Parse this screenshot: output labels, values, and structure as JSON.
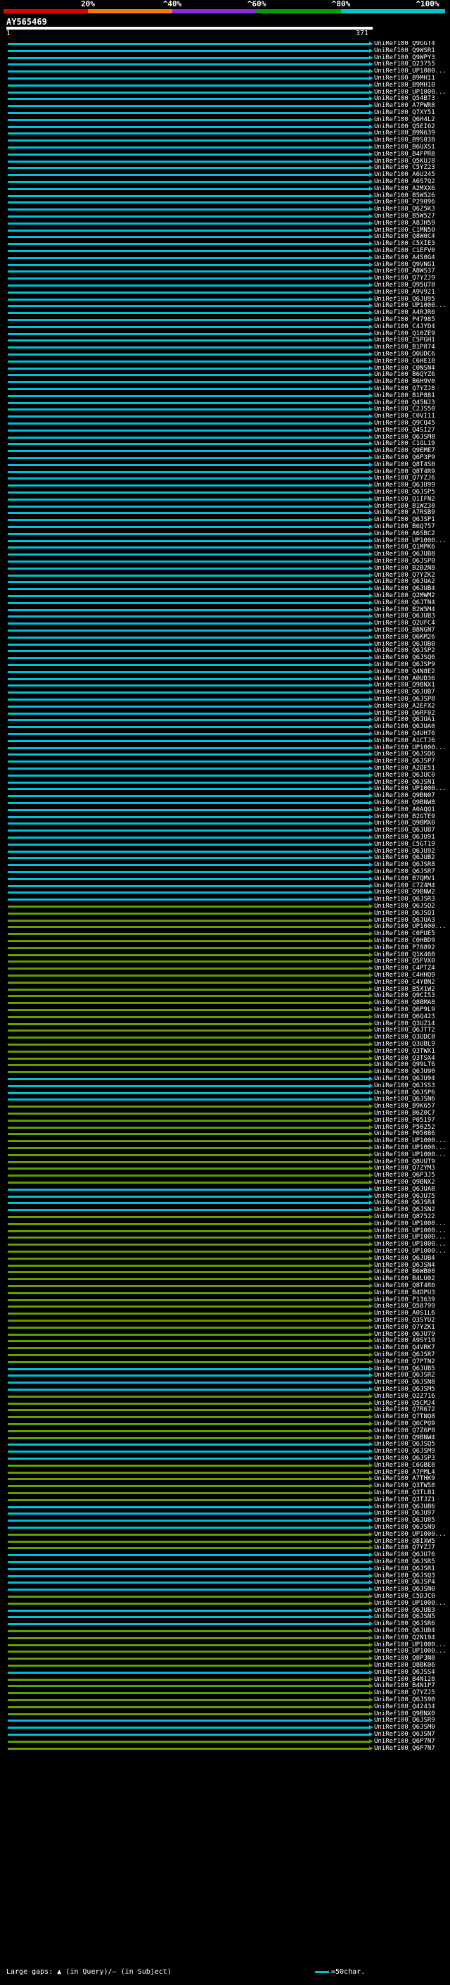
{
  "scale": {
    "ticks": [
      "20%",
      "^40%",
      "^60%",
      "^80%",
      "^100%"
    ],
    "colors": [
      "#e00000",
      "#f07f00",
      "#8a2be2",
      "#00a000",
      "#00c8c8"
    ]
  },
  "query": {
    "name": "AY565469",
    "start": "1",
    "end": "371"
  },
  "hit_colors": {
    "cyan": "#00c0d8",
    "green": "#60a000"
  },
  "hits": [
    {
      "l": "UniRef100_Q9GGT4",
      "c": "cyan"
    },
    {
      "l": "UniRef100_Q9WSR1",
      "c": "cyan"
    },
    {
      "l": "UniRef100_Q9WPY3",
      "c": "cyan"
    },
    {
      "l": "UniRef100_Q23755",
      "c": "cyan"
    },
    {
      "l": "UniRef100_UP1000...",
      "c": "cyan"
    },
    {
      "l": "UniRef100_B9MH11",
      "c": "cyan"
    },
    {
      "l": "UniRef100_B9MH10",
      "c": "cyan"
    },
    {
      "l": "UniRef100_UP1000...",
      "c": "cyan"
    },
    {
      "l": "UniRef100_Q54B73",
      "c": "cyan"
    },
    {
      "l": "UniRef100_A7PWR8",
      "c": "cyan"
    },
    {
      "l": "UniRef100_Q7XY51",
      "c": "cyan"
    },
    {
      "l": "UniRef100_Q6H4L2",
      "c": "cyan"
    },
    {
      "l": "UniRef100_Q5EI62",
      "c": "cyan"
    },
    {
      "l": "UniRef100_B9N639",
      "c": "cyan"
    },
    {
      "l": "UniRef100_B9S038",
      "c": "cyan"
    },
    {
      "l": "UniRef100_B6UXS1",
      "c": "cyan"
    },
    {
      "l": "UniRef100_B4FPR8",
      "c": "cyan"
    },
    {
      "l": "UniRef100_Q5KUJ8",
      "c": "cyan"
    },
    {
      "l": "UniRef100_C5YZ23",
      "c": "cyan"
    },
    {
      "l": "UniRef100_A6U245",
      "c": "cyan"
    },
    {
      "l": "UniRef100_A6S7Q2",
      "c": "cyan"
    },
    {
      "l": "UniRef100_A2MXX6",
      "c": "cyan"
    },
    {
      "l": "UniRef100_B5W526",
      "c": "cyan"
    },
    {
      "l": "UniRef100_P29096",
      "c": "cyan"
    },
    {
      "l": "UniRef100_Q6Z5K3",
      "c": "cyan"
    },
    {
      "l": "UniRef100_B5W527",
      "c": "cyan"
    },
    {
      "l": "UniRef100_A8JH59",
      "c": "cyan"
    },
    {
      "l": "UniRef100_C1MN50",
      "c": "cyan"
    },
    {
      "l": "UniRef100_Q8W0C4",
      "c": "cyan"
    },
    {
      "l": "UniRef100_C5XIE3",
      "c": "cyan"
    },
    {
      "l": "UniRef100_C1EFV0",
      "c": "cyan"
    },
    {
      "l": "UniRef100_A4S0G4",
      "c": "cyan"
    },
    {
      "l": "UniRef100_Q9VNG1",
      "c": "cyan"
    },
    {
      "l": "UniRef100_A8WS37",
      "c": "cyan"
    },
    {
      "l": "UniRef100_Q7YZJ9",
      "c": "cyan"
    },
    {
      "l": "UniRef100_Q95U78",
      "c": "cyan"
    },
    {
      "l": "UniRef100_A9V921",
      "c": "cyan"
    },
    {
      "l": "UniRef100_Q6JU95",
      "c": "cyan"
    },
    {
      "l": "UniRef100_UP1000...",
      "c": "cyan"
    },
    {
      "l": "UniRef100_A4RJR6",
      "c": "cyan"
    },
    {
      "l": "UniRef100_P47985",
      "c": "cyan"
    },
    {
      "l": "UniRef100_C4JYD4",
      "c": "cyan"
    },
    {
      "l": "UniRef100_Q10ZE9",
      "c": "cyan"
    },
    {
      "l": "UniRef100_C5PGH1",
      "c": "cyan"
    },
    {
      "l": "UniRef100_B1P874",
      "c": "cyan"
    },
    {
      "l": "UniRef100_Q0UDC6",
      "c": "cyan"
    },
    {
      "l": "UniRef100_C6HE18",
      "c": "cyan"
    },
    {
      "l": "UniRef100_C0NSN4",
      "c": "cyan"
    },
    {
      "l": "UniRef100_B6QYZ6",
      "c": "cyan"
    },
    {
      "l": "UniRef100_B6H9V0",
      "c": "cyan"
    },
    {
      "l": "UniRef100_Q7YZJ8",
      "c": "cyan"
    },
    {
      "l": "UniRef100_B1P881",
      "c": "cyan"
    },
    {
      "l": "UniRef100_Q45NJ3",
      "c": "cyan"
    },
    {
      "l": "UniRef100_C2JS50",
      "c": "cyan"
    },
    {
      "l": "UniRef100_C0VI11",
      "c": "cyan"
    },
    {
      "l": "UniRef100_Q9CQ45",
      "c": "cyan"
    },
    {
      "l": "UniRef100_Q4SI27",
      "c": "cyan"
    },
    {
      "l": "UniRef100_Q6JSM8",
      "c": "cyan"
    },
    {
      "l": "UniRef100_C1GL19",
      "c": "cyan"
    },
    {
      "l": "UniRef100_Q9EME7",
      "c": "cyan"
    },
    {
      "l": "UniRef100_Q6P3P9",
      "c": "cyan"
    },
    {
      "l": "UniRef100_Q8T4S0",
      "c": "cyan"
    },
    {
      "l": "UniRef100_Q8T4R9",
      "c": "cyan"
    },
    {
      "l": "UniRef100_Q7YZJ6",
      "c": "cyan"
    },
    {
      "l": "UniRef100_Q6JU99",
      "c": "cyan"
    },
    {
      "l": "UniRef100_Q6JSP5",
      "c": "cyan"
    },
    {
      "l": "UniRef100_Q1IFN2",
      "c": "cyan"
    },
    {
      "l": "UniRef100_B1WZ38",
      "c": "cyan"
    },
    {
      "l": "UniRef100_A7RSB9",
      "c": "cyan"
    },
    {
      "l": "UniRef100_Q6JSP1",
      "c": "cyan"
    },
    {
      "l": "UniRef100_B6Q757",
      "c": "cyan"
    },
    {
      "l": "UniRef100_A6SBC2",
      "c": "cyan"
    },
    {
      "l": "UniRef100_UP1000...",
      "c": "cyan"
    },
    {
      "l": "UniRef100_Q1MPK6",
      "c": "cyan"
    },
    {
      "l": "UniRef100_Q6JUB8",
      "c": "cyan"
    },
    {
      "l": "UniRef100_Q6JSP0",
      "c": "cyan"
    },
    {
      "l": "UniRef100_B2B2N8",
      "c": "cyan"
    },
    {
      "l": "UniRef100_Q7YZK2",
      "c": "cyan"
    },
    {
      "l": "UniRef100_Q6JUA2",
      "c": "cyan"
    },
    {
      "l": "UniRef100_Q6JUB4",
      "c": "cyan"
    },
    {
      "l": "UniRef100_Q2MWM2",
      "c": "cyan"
    },
    {
      "l": "UniRef100_Q6JTN4",
      "c": "cyan"
    },
    {
      "l": "UniRef100_B2W5M4",
      "c": "cyan"
    },
    {
      "l": "UniRef100_Q6JUB3",
      "c": "cyan"
    },
    {
      "l": "UniRef100_Q2UFC4",
      "c": "cyan"
    },
    {
      "l": "UniRef100_B8NGN7",
      "c": "cyan"
    },
    {
      "l": "UniRef100_Q6KM26",
      "c": "cyan"
    },
    {
      "l": "UniRef100_Q6JUB0",
      "c": "cyan"
    },
    {
      "l": "UniRef100_Q6JSP2",
      "c": "cyan"
    },
    {
      "l": "UniRef100_Q6JSQ6",
      "c": "cyan"
    },
    {
      "l": "UniRef100_Q6JSP9",
      "c": "cyan"
    },
    {
      "l": "UniRef100_Q4N8E2",
      "c": "cyan"
    },
    {
      "l": "UniRef100_A0UD36",
      "c": "cyan"
    },
    {
      "l": "UniRef100_Q9BNX1",
      "c": "cyan"
    },
    {
      "l": "UniRef100_Q6JUB7",
      "c": "cyan"
    },
    {
      "l": "UniRef100_Q6JSP8",
      "c": "cyan"
    },
    {
      "l": "UniRef100_A2EFX2",
      "c": "cyan"
    },
    {
      "l": "UniRef100_Q6RF02",
      "c": "cyan"
    },
    {
      "l": "UniRef100_Q6JUA1",
      "c": "cyan"
    },
    {
      "l": "UniRef100_Q6JUA0",
      "c": "cyan"
    },
    {
      "l": "UniRef100_Q4UH76",
      "c": "cyan"
    },
    {
      "l": "UniRef100_A1CTJ6",
      "c": "cyan"
    },
    {
      "l": "UniRef100_UP1000...",
      "c": "cyan"
    },
    {
      "l": "UniRef100_Q6JSQ6",
      "c": "cyan"
    },
    {
      "l": "UniRef100_Q6JSP7",
      "c": "cyan"
    },
    {
      "l": "UniRef100_A2DE51",
      "c": "cyan"
    },
    {
      "l": "UniRef100_Q6JUC0",
      "c": "cyan"
    },
    {
      "l": "UniRef100_Q6JSN1",
      "c": "cyan"
    },
    {
      "l": "UniRef100_UP1000...",
      "c": "cyan"
    },
    {
      "l": "UniRef100_Q9BN07",
      "c": "cyan"
    },
    {
      "l": "UniRef100_Q9BNW8",
      "c": "cyan"
    },
    {
      "l": "UniRef100_A0AQQ1",
      "c": "cyan"
    },
    {
      "l": "UniRef100_B2GTE9",
      "c": "cyan"
    },
    {
      "l": "UniRef100_Q9BMX0",
      "c": "cyan"
    },
    {
      "l": "UniRef100_Q6JUB7",
      "c": "cyan"
    },
    {
      "l": "UniRef100_Q6JU91",
      "c": "cyan"
    },
    {
      "l": "UniRef100_C5GT19",
      "c": "cyan"
    },
    {
      "l": "UniRef100_Q6JU92",
      "c": "cyan"
    },
    {
      "l": "UniRef100_Q6JUB2",
      "c": "cyan"
    },
    {
      "l": "UniRef100_Q6JSR8",
      "c": "cyan"
    },
    {
      "l": "UniRef100_Q6JSR7",
      "c": "cyan"
    },
    {
      "l": "UniRef100_B7QMV1",
      "c": "cyan"
    },
    {
      "l": "UniRef100_C7Z4M4",
      "c": "cyan"
    },
    {
      "l": "UniRef100_Q9BNW2",
      "c": "cyan"
    },
    {
      "l": "UniRef100_Q6JSR3",
      "c": "cyan"
    },
    {
      "l": "UniRef100_Q6JSQ2",
      "c": "green"
    },
    {
      "l": "UniRef100_Q6JSQ1",
      "c": "green"
    },
    {
      "l": "UniRef100_Q6JUA3",
      "c": "green"
    },
    {
      "l": "UniRef100_UP1000...",
      "c": "green"
    },
    {
      "l": "UniRef100_C0PUE5",
      "c": "green"
    },
    {
      "l": "UniRef100_C0HBD9",
      "c": "green"
    },
    {
      "l": "UniRef100_P78892",
      "c": "green"
    },
    {
      "l": "UniRef100_Q1K460",
      "c": "green"
    },
    {
      "l": "UniRef100_Q5FVX0",
      "c": "green"
    },
    {
      "l": "UniRef100_C4PTZ4",
      "c": "green"
    },
    {
      "l": "UniRef100_C4HHQ9",
      "c": "green"
    },
    {
      "l": "UniRef100_C4YBN2",
      "c": "green"
    },
    {
      "l": "UniRef100_B5X1W2",
      "c": "green"
    },
    {
      "l": "UniRef100_Q9CI53",
      "c": "green"
    },
    {
      "l": "UniRef100_Q8BMA8",
      "c": "green"
    },
    {
      "l": "UniRef100_Q6P9L9",
      "c": "green"
    },
    {
      "l": "UniRef100_Q6Q423",
      "c": "green"
    },
    {
      "l": "UniRef100_Q3UZ14",
      "c": "green"
    },
    {
      "l": "UniRef100_Q6JTT2",
      "c": "green"
    },
    {
      "l": "UniRef100_Q3UDC8",
      "c": "green"
    },
    {
      "l": "UniRef100_Q3UBL9",
      "c": "green"
    },
    {
      "l": "UniRef100_Q3TWX1",
      "c": "green"
    },
    {
      "l": "UniRef100_Q3TSX4",
      "c": "green"
    },
    {
      "l": "UniRef100_Q99LT6",
      "c": "green"
    },
    {
      "l": "UniRef100_Q6JU90",
      "c": "green"
    },
    {
      "l": "UniRef100_Q6JU94",
      "c": "cyan"
    },
    {
      "l": "UniRef100_Q6JSS3",
      "c": "cyan"
    },
    {
      "l": "UniRef100_Q6JSP6",
      "c": "cyan"
    },
    {
      "l": "UniRef100_Q6JSN6",
      "c": "cyan"
    },
    {
      "l": "UniRef100_B9K657",
      "c": "green"
    },
    {
      "l": "UniRef100_B6Z0C7",
      "c": "green"
    },
    {
      "l": "UniRef100_P05197",
      "c": "green"
    },
    {
      "l": "UniRef100_P50252",
      "c": "green"
    },
    {
      "l": "UniRef100_P05086",
      "c": "green"
    },
    {
      "l": "UniRef100_UP1000...",
      "c": "green"
    },
    {
      "l": "UniRef100_UP1000...",
      "c": "green"
    },
    {
      "l": "UniRef100_UP1000...",
      "c": "green"
    },
    {
      "l": "UniRef100_Q8UUT9",
      "c": "green"
    },
    {
      "l": "UniRef100_Q7ZYM3",
      "c": "green"
    },
    {
      "l": "UniRef100_Q6P3J5",
      "c": "green"
    },
    {
      "l": "UniRef100_Q9BNX2",
      "c": "green"
    },
    {
      "l": "UniRef100_Q6JUA8",
      "c": "cyan"
    },
    {
      "l": "UniRef100_Q6JU75",
      "c": "cyan"
    },
    {
      "l": "UniRef100_Q6JSR4",
      "c": "cyan"
    },
    {
      "l": "UniRef100_Q6JSN2",
      "c": "cyan"
    },
    {
      "l": "UniRef100_Q87522",
      "c": "green"
    },
    {
      "l": "UniRef100_UP1000...",
      "c": "green"
    },
    {
      "l": "UniRef100_UP1000...",
      "c": "green"
    },
    {
      "l": "UniRef100_UP1000...",
      "c": "green"
    },
    {
      "l": "UniRef100_UP1000...",
      "c": "green"
    },
    {
      "l": "UniRef100_UP1000...",
      "c": "green"
    },
    {
      "l": "UniRef100_Q6JUB4",
      "c": "green"
    },
    {
      "l": "UniRef100_Q6JSN4",
      "c": "green"
    },
    {
      "l": "UniRef100_B6WB08",
      "c": "green"
    },
    {
      "l": "UniRef100_B4LU02",
      "c": "green"
    },
    {
      "l": "UniRef100_Q8T4R0",
      "c": "green"
    },
    {
      "l": "UniRef100_B4DPU3",
      "c": "green"
    },
    {
      "l": "UniRef100_P13639",
      "c": "green"
    },
    {
      "l": "UniRef100_Q58799",
      "c": "green"
    },
    {
      "l": "UniRef100_A0S1L6",
      "c": "green"
    },
    {
      "l": "UniRef100_Q3SYU2",
      "c": "green"
    },
    {
      "l": "UniRef100_Q7YZK1",
      "c": "green"
    },
    {
      "l": "UniRef100_Q6JU79",
      "c": "green"
    },
    {
      "l": "UniRef100_A9SY19",
      "c": "green"
    },
    {
      "l": "UniRef100_Q4VRK7",
      "c": "green"
    },
    {
      "l": "UniRef100_Q6JSR7",
      "c": "green"
    },
    {
      "l": "UniRef100_Q7PTN2",
      "c": "green"
    },
    {
      "l": "UniRef100_Q6JUB5",
      "c": "cyan"
    },
    {
      "l": "UniRef100_Q6JSR2",
      "c": "cyan"
    },
    {
      "l": "UniRef100_Q6JSN8",
      "c": "cyan"
    },
    {
      "l": "UniRef100_Q6JSM5",
      "c": "cyan"
    },
    {
      "l": "UniRef100_Q2Z716",
      "c": "green"
    },
    {
      "l": "UniRef100_Q5CMJ4",
      "c": "green"
    },
    {
      "l": "UniRef100_Q7R672",
      "c": "green"
    },
    {
      "l": "UniRef100_Q7TNQ8",
      "c": "green"
    },
    {
      "l": "UniRef100_Q6CPQ9",
      "c": "green"
    },
    {
      "l": "UniRef100_Q7Z6P8",
      "c": "green"
    },
    {
      "l": "UniRef100_Q9BNW4",
      "c": "green"
    },
    {
      "l": "UniRef100_Q6JSQ5",
      "c": "cyan"
    },
    {
      "l": "UniRef100_Q6JSM9",
      "c": "cyan"
    },
    {
      "l": "UniRef100_Q6JSP3",
      "c": "cyan"
    },
    {
      "l": "UniRef100_C6GBE8",
      "c": "green"
    },
    {
      "l": "UniRef100_A7PML4",
      "c": "green"
    },
    {
      "l": "UniRef100_A7THK9",
      "c": "green"
    },
    {
      "l": "UniRef100_Q3TW58",
      "c": "green"
    },
    {
      "l": "UniRef100_Q3TLB1",
      "c": "green"
    },
    {
      "l": "UniRef100_Q3TJZ1",
      "c": "green"
    },
    {
      "l": "UniRef100_Q6JUB6",
      "c": "cyan"
    },
    {
      "l": "UniRef100_Q6JU97",
      "c": "cyan"
    },
    {
      "l": "UniRef100_Q6JU85",
      "c": "cyan"
    },
    {
      "l": "UniRef100_Q6JSN9",
      "c": "cyan"
    },
    {
      "l": "UniRef100_UP1000...",
      "c": "green"
    },
    {
      "l": "UniRef100_Q8IXW5",
      "c": "green"
    },
    {
      "l": "UniRef100_Q7YZJ7",
      "c": "green"
    },
    {
      "l": "UniRef100_Q6JU76",
      "c": "cyan"
    },
    {
      "l": "UniRef100_Q6JSR5",
      "c": "cyan"
    },
    {
      "l": "UniRef100_Q6JSR1",
      "c": "cyan"
    },
    {
      "l": "UniRef100_Q6JSQ3",
      "c": "cyan"
    },
    {
      "l": "UniRef100_Q6JSP4",
      "c": "cyan"
    },
    {
      "l": "UniRef100_Q6JSN0",
      "c": "cyan"
    },
    {
      "l": "UniRef100_C5DJC0",
      "c": "green"
    },
    {
      "l": "UniRef100_UP1000...",
      "c": "green"
    },
    {
      "l": "UniRef100_Q6JUB3",
      "c": "cyan"
    },
    {
      "l": "UniRef100_Q6JSN5",
      "c": "cyan"
    },
    {
      "l": "UniRef100_Q6JSR6",
      "c": "cyan"
    },
    {
      "l": "UniRef100_Q6JUB4",
      "c": "green"
    },
    {
      "l": "UniRef100_Q2N194",
      "c": "green"
    },
    {
      "l": "UniRef100_UP1000...",
      "c": "green"
    },
    {
      "l": "UniRef100_UP1000...",
      "c": "green"
    },
    {
      "l": "UniRef100_Q8P3N8",
      "c": "green"
    },
    {
      "l": "UniRef100_Q8BK06",
      "c": "green"
    },
    {
      "l": "UniRef100_Q6JSS4",
      "c": "cyan"
    },
    {
      "l": "UniRef100_B4N128",
      "c": "green"
    },
    {
      "l": "UniRef100_B4N1P7",
      "c": "green"
    },
    {
      "l": "UniRef100_Q7YZJ5",
      "c": "green"
    },
    {
      "l": "UniRef100_Q6JS90",
      "c": "green"
    },
    {
      "l": "UniRef100_Q42434",
      "c": "green"
    },
    {
      "l": "UniRef100_Q9BNX0",
      "c": "green"
    },
    {
      "l": "UniRef100_Q6JSR9",
      "c": "cyan"
    },
    {
      "l": "UniRef100_Q6JSM0",
      "c": "cyan"
    },
    {
      "l": "UniRef100_Q6JSN7",
      "c": "cyan"
    },
    {
      "l": "UniRef100_Q6P7N7",
      "c": "green"
    },
    {
      "l": "UniRef100_Q6P7N7",
      "c": "green"
    }
  ],
  "footer": {
    "large_gaps": "Large gaps:",
    "gap_legend": "(in Query)/– (in Subject)",
    "scale_legend": "=50char."
  }
}
